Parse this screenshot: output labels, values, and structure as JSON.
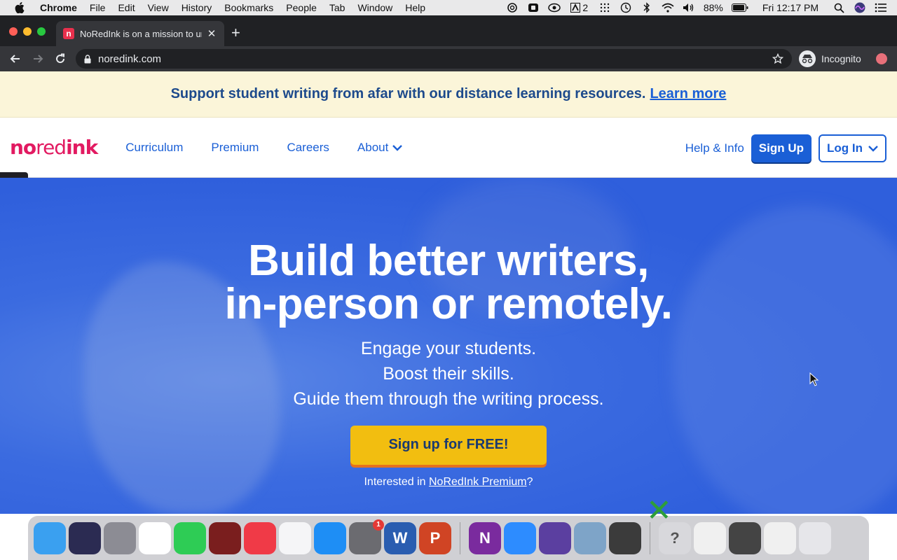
{
  "menubar": {
    "app_name": "Chrome",
    "items": [
      "File",
      "Edit",
      "View",
      "History",
      "Bookmarks",
      "People",
      "Tab",
      "Window",
      "Help"
    ],
    "adobe_count": "2",
    "battery": "88%",
    "clock": "Fri 12:17 PM"
  },
  "browser": {
    "tab_title": "NoRedInk is on a mission to unl",
    "tab_favicon": "n",
    "url": "noredink.com",
    "profile_label": "Incognito"
  },
  "banner": {
    "text": "Support student writing from afar with our distance learning resources.",
    "link": "Learn more"
  },
  "header": {
    "logo_no": "no",
    "logo_red": "red",
    "logo_ink": "ink",
    "nav": [
      "Curriculum",
      "Premium",
      "Careers",
      "About"
    ],
    "help": "Help & Info",
    "signup": "Sign Up",
    "login": "Log In"
  },
  "hero": {
    "title_line1": "Build better writers,",
    "title_line2": "in-person or remotely.",
    "sub1": "Engage your students.",
    "sub2": "Boost their skills.",
    "sub3": "Guide them through the writing process.",
    "cta": "Sign up for FREE!",
    "premium_prefix": "Interested in",
    "premium_link": "NoRedInk Premium",
    "premium_suffix": "?"
  },
  "dock": {
    "apps": [
      {
        "name": "finder-icon",
        "label": "",
        "color": "#3aa0f0"
      },
      {
        "name": "siri-icon",
        "label": "",
        "color": "#2b2b52"
      },
      {
        "name": "launchpad-icon",
        "label": "",
        "color": "#8c8c94"
      },
      {
        "name": "chrome-icon",
        "label": "",
        "color": "#ffffff"
      },
      {
        "name": "facetime-icon",
        "label": "",
        "color": "#2ecc55"
      },
      {
        "name": "photo-booth-icon",
        "label": "",
        "color": "#7a1e1e"
      },
      {
        "name": "news-icon",
        "label": "",
        "color": "#f03a47"
      },
      {
        "name": "itunes-icon",
        "label": "",
        "color": "#f5f5f7"
      },
      {
        "name": "app-store-icon",
        "label": "",
        "color": "#1e8ef5"
      },
      {
        "name": "system-preferences-icon",
        "label": "",
        "color": "#6b6b70",
        "badge": "1"
      },
      {
        "name": "word-icon",
        "label": "W",
        "color": "#2a5db0"
      },
      {
        "name": "powerpoint-icon",
        "label": "P",
        "color": "#d04424"
      }
    ],
    "apps2": [
      {
        "name": "onenote-icon",
        "label": "N",
        "color": "#7a2b9e"
      },
      {
        "name": "zoom-icon",
        "label": "",
        "color": "#2d8cff"
      },
      {
        "name": "imovie-icon",
        "label": "",
        "color": "#5b3fa0"
      },
      {
        "name": "preview-icon",
        "label": "",
        "color": "#7ea4c8"
      },
      {
        "name": "vectorworks-icon",
        "label": "",
        "color": "#3b3b3b"
      }
    ],
    "apps3": [
      {
        "name": "help-icon",
        "label": "?",
        "color": "#d8d8dc"
      },
      {
        "name": "word-doc-icon",
        "label": "",
        "color": "#f0f0f0"
      },
      {
        "name": "imovie-project-icon",
        "label": "",
        "color": "#444444"
      },
      {
        "name": "excel-doc-icon",
        "label": "",
        "color": "#f0f0f0"
      },
      {
        "name": "trash-icon",
        "label": "",
        "color": "#e6e6ea"
      }
    ]
  }
}
